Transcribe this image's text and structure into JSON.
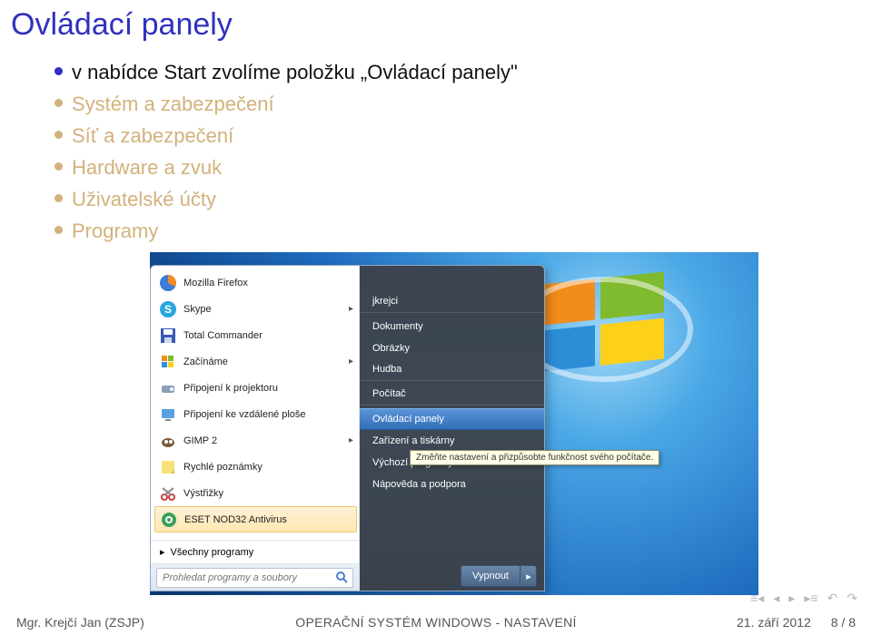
{
  "slide": {
    "title": "Ovládací panely",
    "bullets": [
      {
        "text": "v nabídce Start zvolíme položku „Ovládací panely\"",
        "faded": false
      },
      {
        "text": "Systém a zabezpečení",
        "faded": true
      },
      {
        "text": "Síť a zabezpečení",
        "faded": true
      },
      {
        "text": "Hardware a zvuk",
        "faded": true
      },
      {
        "text": "Uživatelské účty",
        "faded": true
      },
      {
        "text": "Programy",
        "faded": true
      }
    ]
  },
  "start_menu": {
    "left_programs": [
      {
        "label": "Mozilla Firefox",
        "has_sub": false,
        "icon": "firefox"
      },
      {
        "label": "Skype",
        "has_sub": true,
        "icon": "skype"
      },
      {
        "label": "Total Commander",
        "has_sub": false,
        "icon": "tcmd"
      },
      {
        "label": "Začínáme",
        "has_sub": true,
        "icon": "flag"
      },
      {
        "label": "Připojení k projektoru",
        "has_sub": false,
        "icon": "projector"
      },
      {
        "label": "Připojení ke vzdálené ploše",
        "has_sub": false,
        "icon": "rdp"
      },
      {
        "label": "GIMP 2",
        "has_sub": true,
        "icon": "gimp"
      },
      {
        "label": "Rychlé poznámky",
        "has_sub": false,
        "icon": "notes"
      },
      {
        "label": "Výstřižky",
        "has_sub": false,
        "icon": "snip"
      },
      {
        "label": "ESET NOD32 Antivirus",
        "has_sub": false,
        "icon": "eset",
        "highlight": true
      }
    ],
    "all_programs": "Všechny programy",
    "search_placeholder": "Prohledat programy a soubory",
    "right_items": [
      {
        "label": "jkrejci",
        "sep": true
      },
      {
        "label": "Dokumenty"
      },
      {
        "label": "Obrázky"
      },
      {
        "label": "Hudba",
        "sep": true
      },
      {
        "label": "Počítač",
        "sep": true
      },
      {
        "label": "Ovládací panely",
        "highlight": true
      },
      {
        "label": "Zařízení a tiskárny"
      },
      {
        "label": "Výchozí programy"
      },
      {
        "label": "Nápověda a podpora"
      }
    ],
    "tooltip": "Změňte nastavení a přizpůsobte funkčnost svého počítače.",
    "shutdown": "Vypnout"
  },
  "footer": {
    "author": "Mgr. Krejčí Jan (ZSJP)",
    "title": "OPERAČNÍ SYSTÉM WINDOWS - NASTAVENÍ",
    "date": "21. září 2012",
    "page": "8 / 8"
  }
}
